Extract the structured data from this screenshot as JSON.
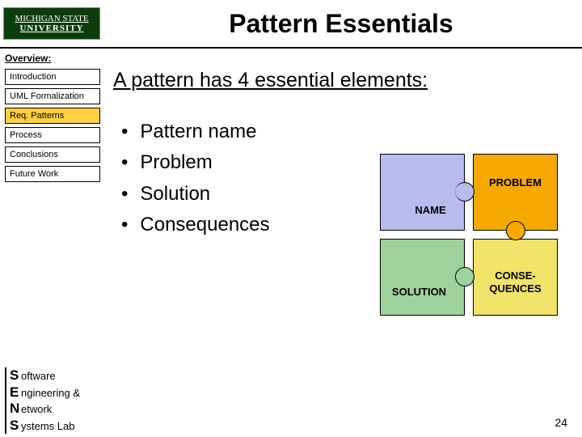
{
  "header": {
    "logo_l1": "MICHIGAN STATE",
    "logo_l2": "UNIVERSITY",
    "title": "Pattern Essentials"
  },
  "sidebar": {
    "label": "Overview:",
    "items": [
      {
        "label": "Introduction",
        "active": false
      },
      {
        "label": "UML Formalization",
        "active": false
      },
      {
        "label": "Req. Patterns",
        "active": true
      },
      {
        "label": "Process",
        "active": false
      },
      {
        "label": "Conclusions",
        "active": false
      },
      {
        "label": "Future Work",
        "active": false
      }
    ]
  },
  "main": {
    "heading": "A pattern has 4 essential elements:",
    "bullets": [
      "Pattern name",
      "Problem",
      "Solution",
      "Consequences"
    ]
  },
  "puzzle": {
    "name": "NAME",
    "problem": "PROBLEM",
    "solution": "SOLUTION",
    "conseq": "CONSE-\nQUENCES"
  },
  "footer": {
    "lines": [
      {
        "big": "S",
        "rest": "oftware"
      },
      {
        "big": "E",
        "rest": "ngineering &"
      },
      {
        "big": "N",
        "rest": "etwork"
      },
      {
        "big": "S",
        "rest": "ystems Lab"
      }
    ]
  },
  "page_number": "24"
}
